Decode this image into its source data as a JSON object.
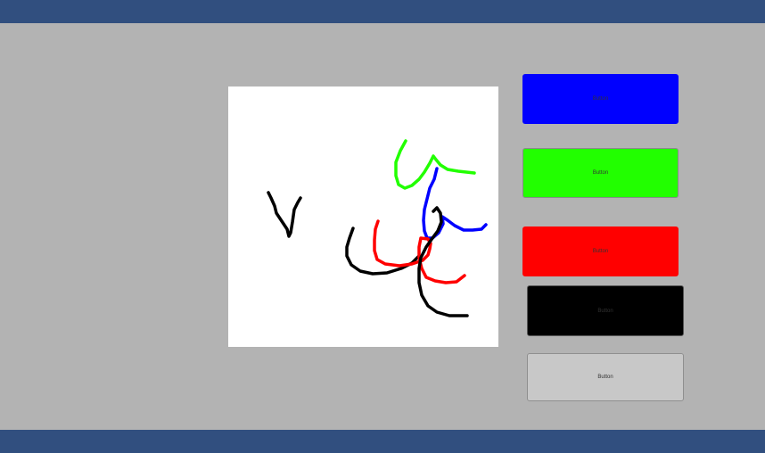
{
  "colors": {
    "header_bar": "#314f7f",
    "footer_bar": "#314f7f",
    "background": "#b3b3b3",
    "canvas": "#ffffff"
  },
  "buttons": [
    {
      "label": "Button",
      "color_name": "blue",
      "color": "#0000ff"
    },
    {
      "label": "Button",
      "color_name": "green",
      "color": "#22ff00"
    },
    {
      "label": "Button",
      "color_name": "red",
      "color": "#ff0000"
    },
    {
      "label": "Button",
      "color_name": "black",
      "color": "#000000"
    },
    {
      "label": "Button",
      "color_name": "gray",
      "color": "#c8c8c8"
    }
  ],
  "strokes": [
    {
      "color": "black"
    },
    {
      "color": "black"
    },
    {
      "color": "green"
    },
    {
      "color": "blue"
    },
    {
      "color": "red"
    },
    {
      "color": "black"
    }
  ]
}
